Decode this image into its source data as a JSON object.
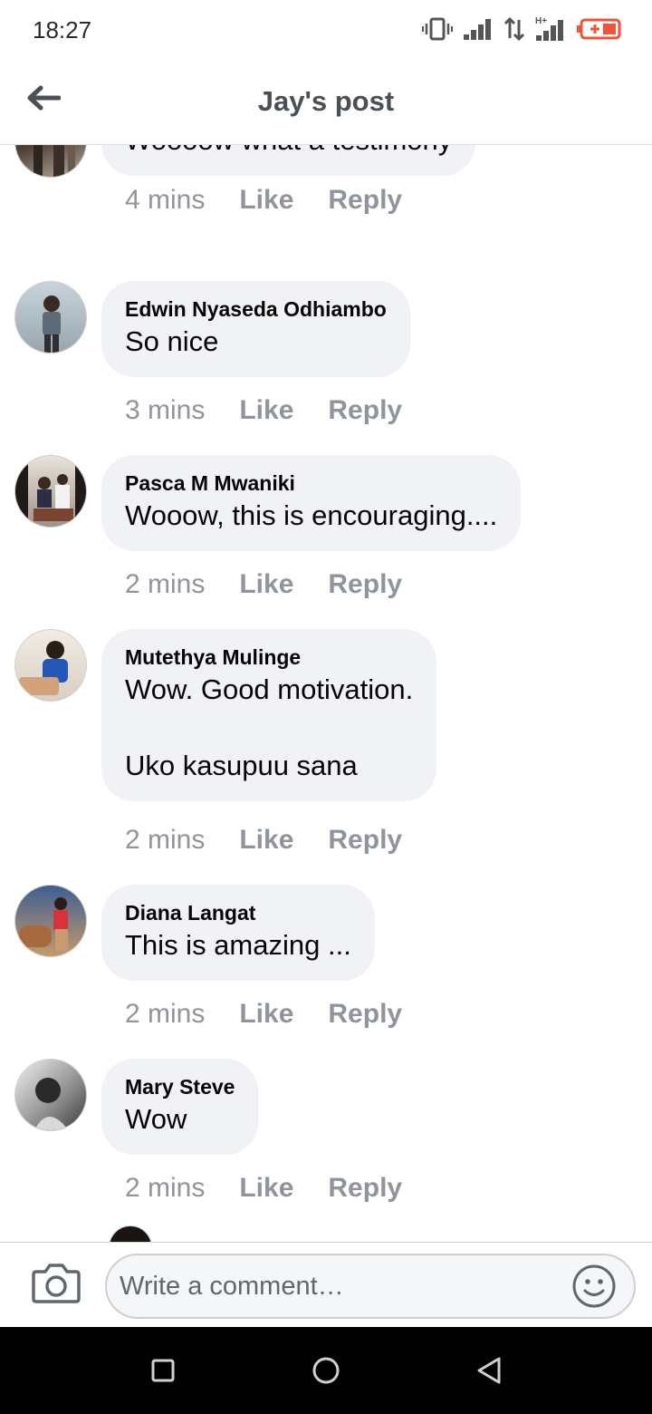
{
  "status_bar": {
    "time": "18:27"
  },
  "header": {
    "title": "Jay's post"
  },
  "comments": [
    {
      "author": "",
      "text": "Woooow what a testimony",
      "time": "4 mins",
      "like": "Like",
      "reply": "Reply"
    },
    {
      "author": "Edwin Nyaseda Odhiambo",
      "text": "So nice",
      "time": "3 mins",
      "like": "Like",
      "reply": "Reply"
    },
    {
      "author": "Pasca M Mwaniki",
      "text": "Wooow, this is encouraging....",
      "time": "2 mins",
      "like": "Like",
      "reply": "Reply"
    },
    {
      "author": "Mutethya Mulinge",
      "text": "Wow. Good motivation.\n\nUko kasupuu sana",
      "time": "2 mins",
      "like": "Like",
      "reply": "Reply"
    },
    {
      "author": "Diana Langat",
      "text": "This is amazing ...",
      "time": "2 mins",
      "like": "Like",
      "reply": "Reply"
    },
    {
      "author": "Mary Steve",
      "text": "Wow",
      "time": "2 mins",
      "like": "Like",
      "reply": "Reply"
    }
  ],
  "composer": {
    "placeholder": "Write a comment…"
  },
  "icons": {
    "back": "back-arrow-icon",
    "camera": "camera-icon",
    "emoji": "smiley-icon",
    "nav_recent": "square-icon",
    "nav_home": "circle-icon",
    "nav_back": "triangle-back-icon"
  },
  "colors": {
    "bubble": "#f0f2f5",
    "meta_text": "#90949c",
    "title_text": "#4b4f56",
    "battery_accent": "#f0533a"
  }
}
